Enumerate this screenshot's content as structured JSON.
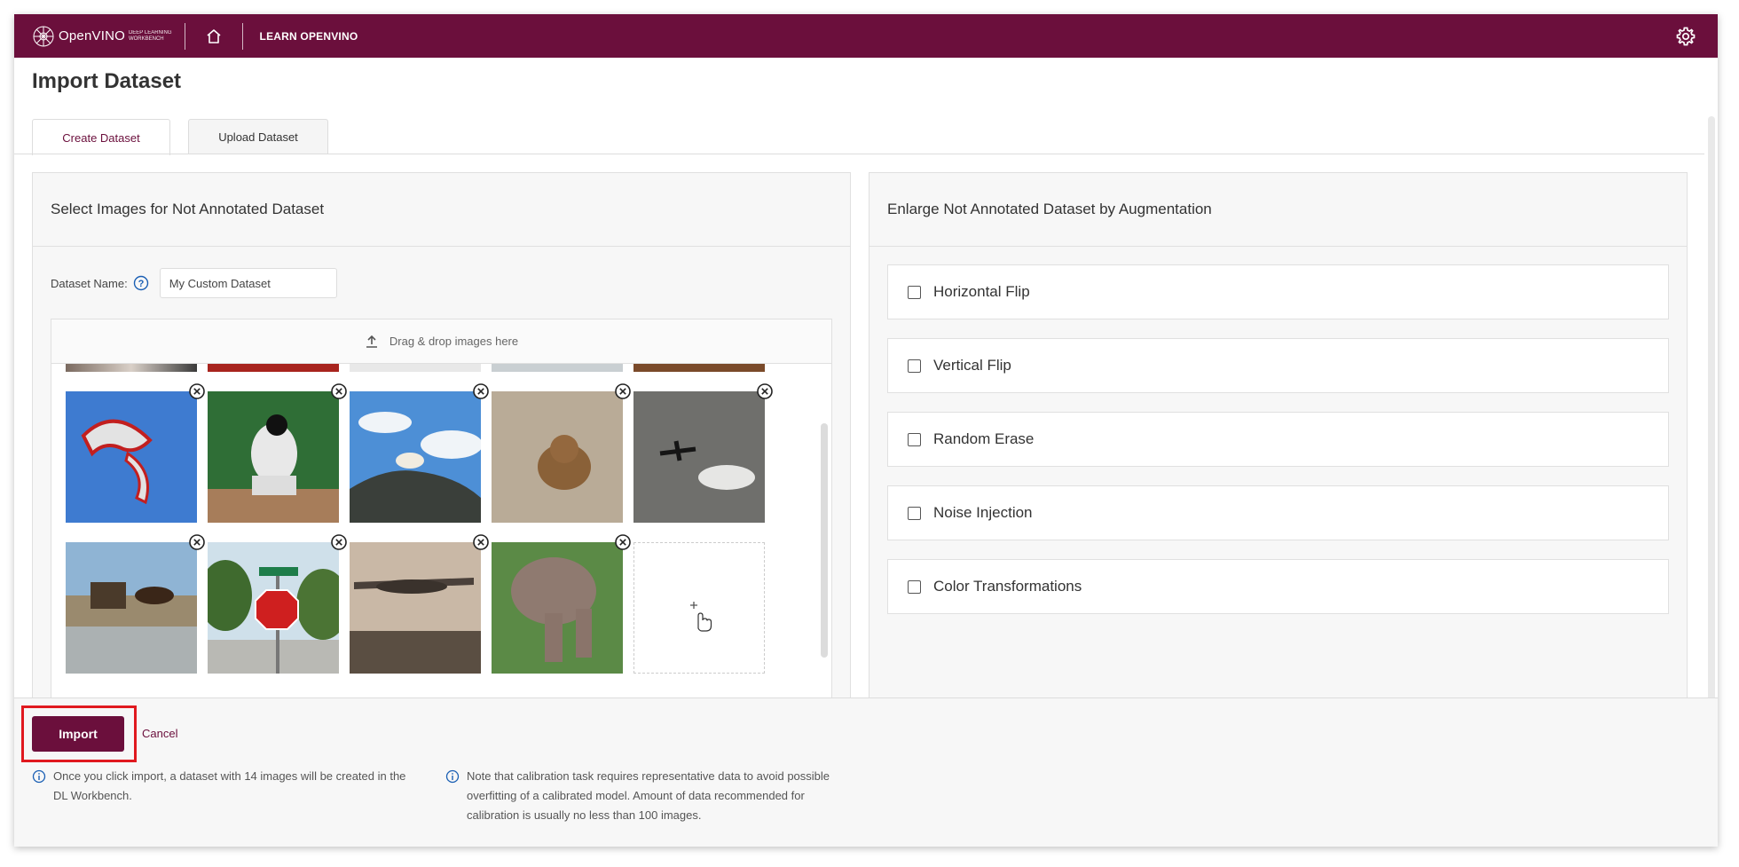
{
  "topbar": {
    "logo_name": "OpenVINO",
    "logo_sub1": "DEEP LEARNING",
    "logo_sub2": "WORKBENCH",
    "learn_label": "LEARN OPENVINO"
  },
  "page": {
    "title": "Import Dataset",
    "tabs": [
      {
        "label": "Create Dataset",
        "active": true
      },
      {
        "label": "Upload Dataset",
        "active": false
      }
    ]
  },
  "left_panel": {
    "title": "Select Images for Not Annotated Dataset",
    "dataset_name_label": "Dataset Name:",
    "dataset_name_value": "My Custom Dataset",
    "dropzone_label": "Drag & drop images here",
    "images_row1": [
      "kite",
      "baseball-catcher",
      "sheep-on-rock",
      "bear",
      "airplane-sky"
    ],
    "images_row2": [
      "horse-carriage",
      "stop-sign",
      "vintage-airplane",
      "elephant"
    ]
  },
  "right_panel": {
    "title": "Enlarge Not Annotated Dataset by Augmentation",
    "options": [
      {
        "label": "Horizontal Flip",
        "checked": false
      },
      {
        "label": "Vertical Flip",
        "checked": false
      },
      {
        "label": "Random Erase",
        "checked": false
      },
      {
        "label": "Noise Injection",
        "checked": false
      },
      {
        "label": "Color Transformations",
        "checked": false
      }
    ]
  },
  "footer": {
    "import_label": "Import",
    "cancel_label": "Cancel",
    "note1": "Once you click import, a dataset with 14 images will be created in the DL Workbench.",
    "note2": "Note that calibration task requires representative data to avoid possible overfitting of a calibrated model. Amount of data recommended for calibration is usually no less than 100 images."
  },
  "colors": {
    "brand": "#6b0f3c",
    "highlight": "#e0191f",
    "info": "#1a5fb4"
  }
}
